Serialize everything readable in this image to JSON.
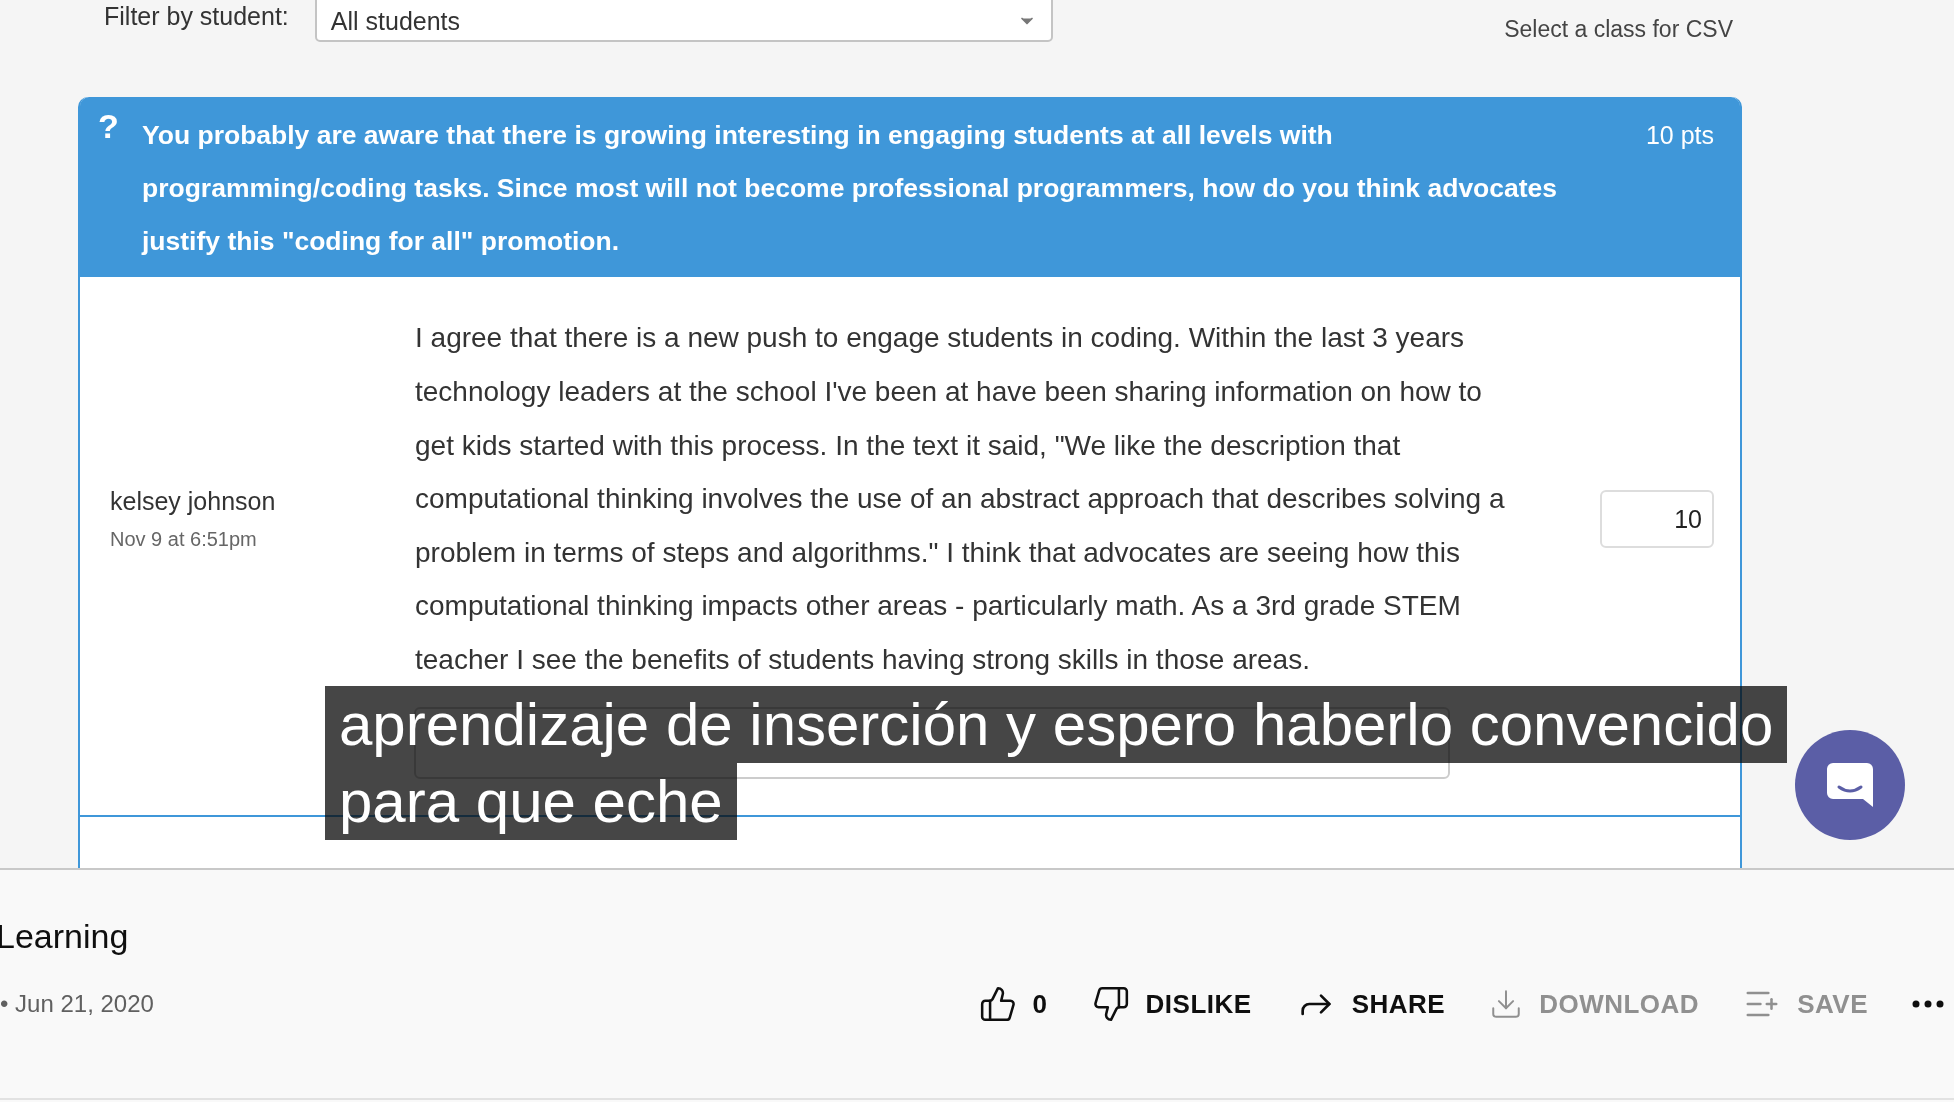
{
  "filter": {
    "label": "Filter by student:",
    "value": "All students"
  },
  "csv_link": "Select a class for CSV",
  "question": {
    "icon": "?",
    "lines": [
      "You probably are aware that there is growing interesting in engaging students at all levels with",
      "programming/coding tasks. Since most will not become professional programmers, how do you think advocates",
      "justify this \"coding for all\" promotion."
    ],
    "points": "10 pts"
  },
  "submission": {
    "student": "kelsey johnson",
    "time": "Nov 9 at 6:51pm",
    "answer": [
      "I agree that there is a new push to engage students in coding. Within the last 3 years",
      "technology leaders at the school I've been at have been sharing information on how to",
      "get kids started with this process. In the text it said, \"We like the description that",
      "computational thinking involves the use of an abstract approach that describes solving a",
      "problem in terms of steps and algorithms.\" I think that advocates are seeing how this",
      "computational thinking impacts other areas - particularly math. As a 3rd grade STEM",
      "teacher I see the benefits of students having strong skills in those areas."
    ],
    "score": "10"
  },
  "subtitles": [
    "aprendizaje de inserción y espero haberlo convencido",
    "para que eche"
  ],
  "video": {
    "title": "Learning",
    "date": "• Jun 21, 2020"
  },
  "actions": [
    {
      "kind": "like",
      "label": "0",
      "disabled": false
    },
    {
      "kind": "dislike",
      "label": "DISLIKE",
      "disabled": false
    },
    {
      "kind": "share",
      "label": "SHARE",
      "disabled": false
    },
    {
      "kind": "download",
      "label": "DOWNLOAD",
      "disabled": true
    },
    {
      "kind": "save",
      "label": "SAVE",
      "disabled": true
    },
    {
      "kind": "more",
      "disabled": false
    }
  ]
}
